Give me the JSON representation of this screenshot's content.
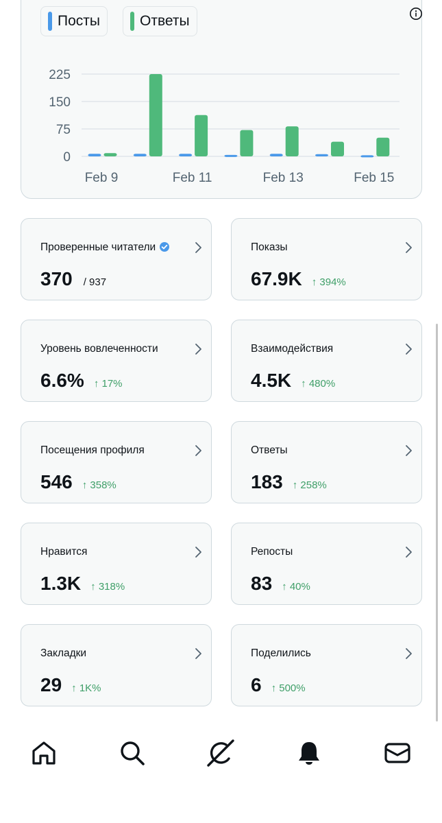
{
  "chart_data": {
    "type": "bar",
    "categories": [
      "Feb 9",
      "Feb 10",
      "Feb 11",
      "Feb 12",
      "Feb 13",
      "Feb 14",
      "Feb 15"
    ],
    "x_tick_labels": [
      "Feb 9",
      "Feb 11",
      "Feb 13",
      "Feb 15"
    ],
    "y_ticks": [
      "225",
      "150",
      "75",
      "0"
    ],
    "ylim": [
      0,
      225
    ],
    "grid": true,
    "legend_placement": "top-left",
    "series": [
      {
        "name": "Посты",
        "color": "#4a99e9",
        "values": [
          7,
          7,
          7,
          4,
          7,
          6,
          3
        ]
      },
      {
        "name": "Ответы",
        "color": "#4fb97b",
        "values": [
          9,
          225,
          113,
          72,
          82,
          40,
          51
        ]
      }
    ]
  },
  "chart": {
    "info_icon": "info-icon"
  },
  "stats": [
    {
      "title": "Проверенные читатели",
      "value": "370",
      "sub": "/ 937",
      "change": "",
      "verified": true
    },
    {
      "title": "Показы",
      "value": "67.9K",
      "sub": "",
      "change": "↑ 394%"
    },
    {
      "title": "Уровень вовлеченности",
      "value": "6.6%",
      "sub": "",
      "change": "↑ 17%"
    },
    {
      "title": "Взаимодействия",
      "value": "4.5K",
      "sub": "",
      "change": "↑ 480%"
    },
    {
      "title": "Посещения профиля",
      "value": "546",
      "sub": "",
      "change": "↑ 358%"
    },
    {
      "title": "Ответы",
      "value": "183",
      "sub": "",
      "change": "↑ 258%"
    },
    {
      "title": "Нравится",
      "value": "1.3K",
      "sub": "",
      "change": "↑ 318%"
    },
    {
      "title": "Репосты",
      "value": "83",
      "sub": "",
      "change": "↑ 40%"
    },
    {
      "title": "Закладки",
      "value": "29",
      "sub": "",
      "change": "↑ 1K%"
    },
    {
      "title": "Поделились",
      "value": "6",
      "sub": "",
      "change": "↑ 500%"
    }
  ],
  "colors": {
    "positive_change": "#3f9f68",
    "verified_badge": "#4a99e9"
  },
  "bottom_nav": [
    "home-icon",
    "search-icon",
    "grok-icon",
    "notifications-bell-icon",
    "messages-envelope-icon"
  ]
}
